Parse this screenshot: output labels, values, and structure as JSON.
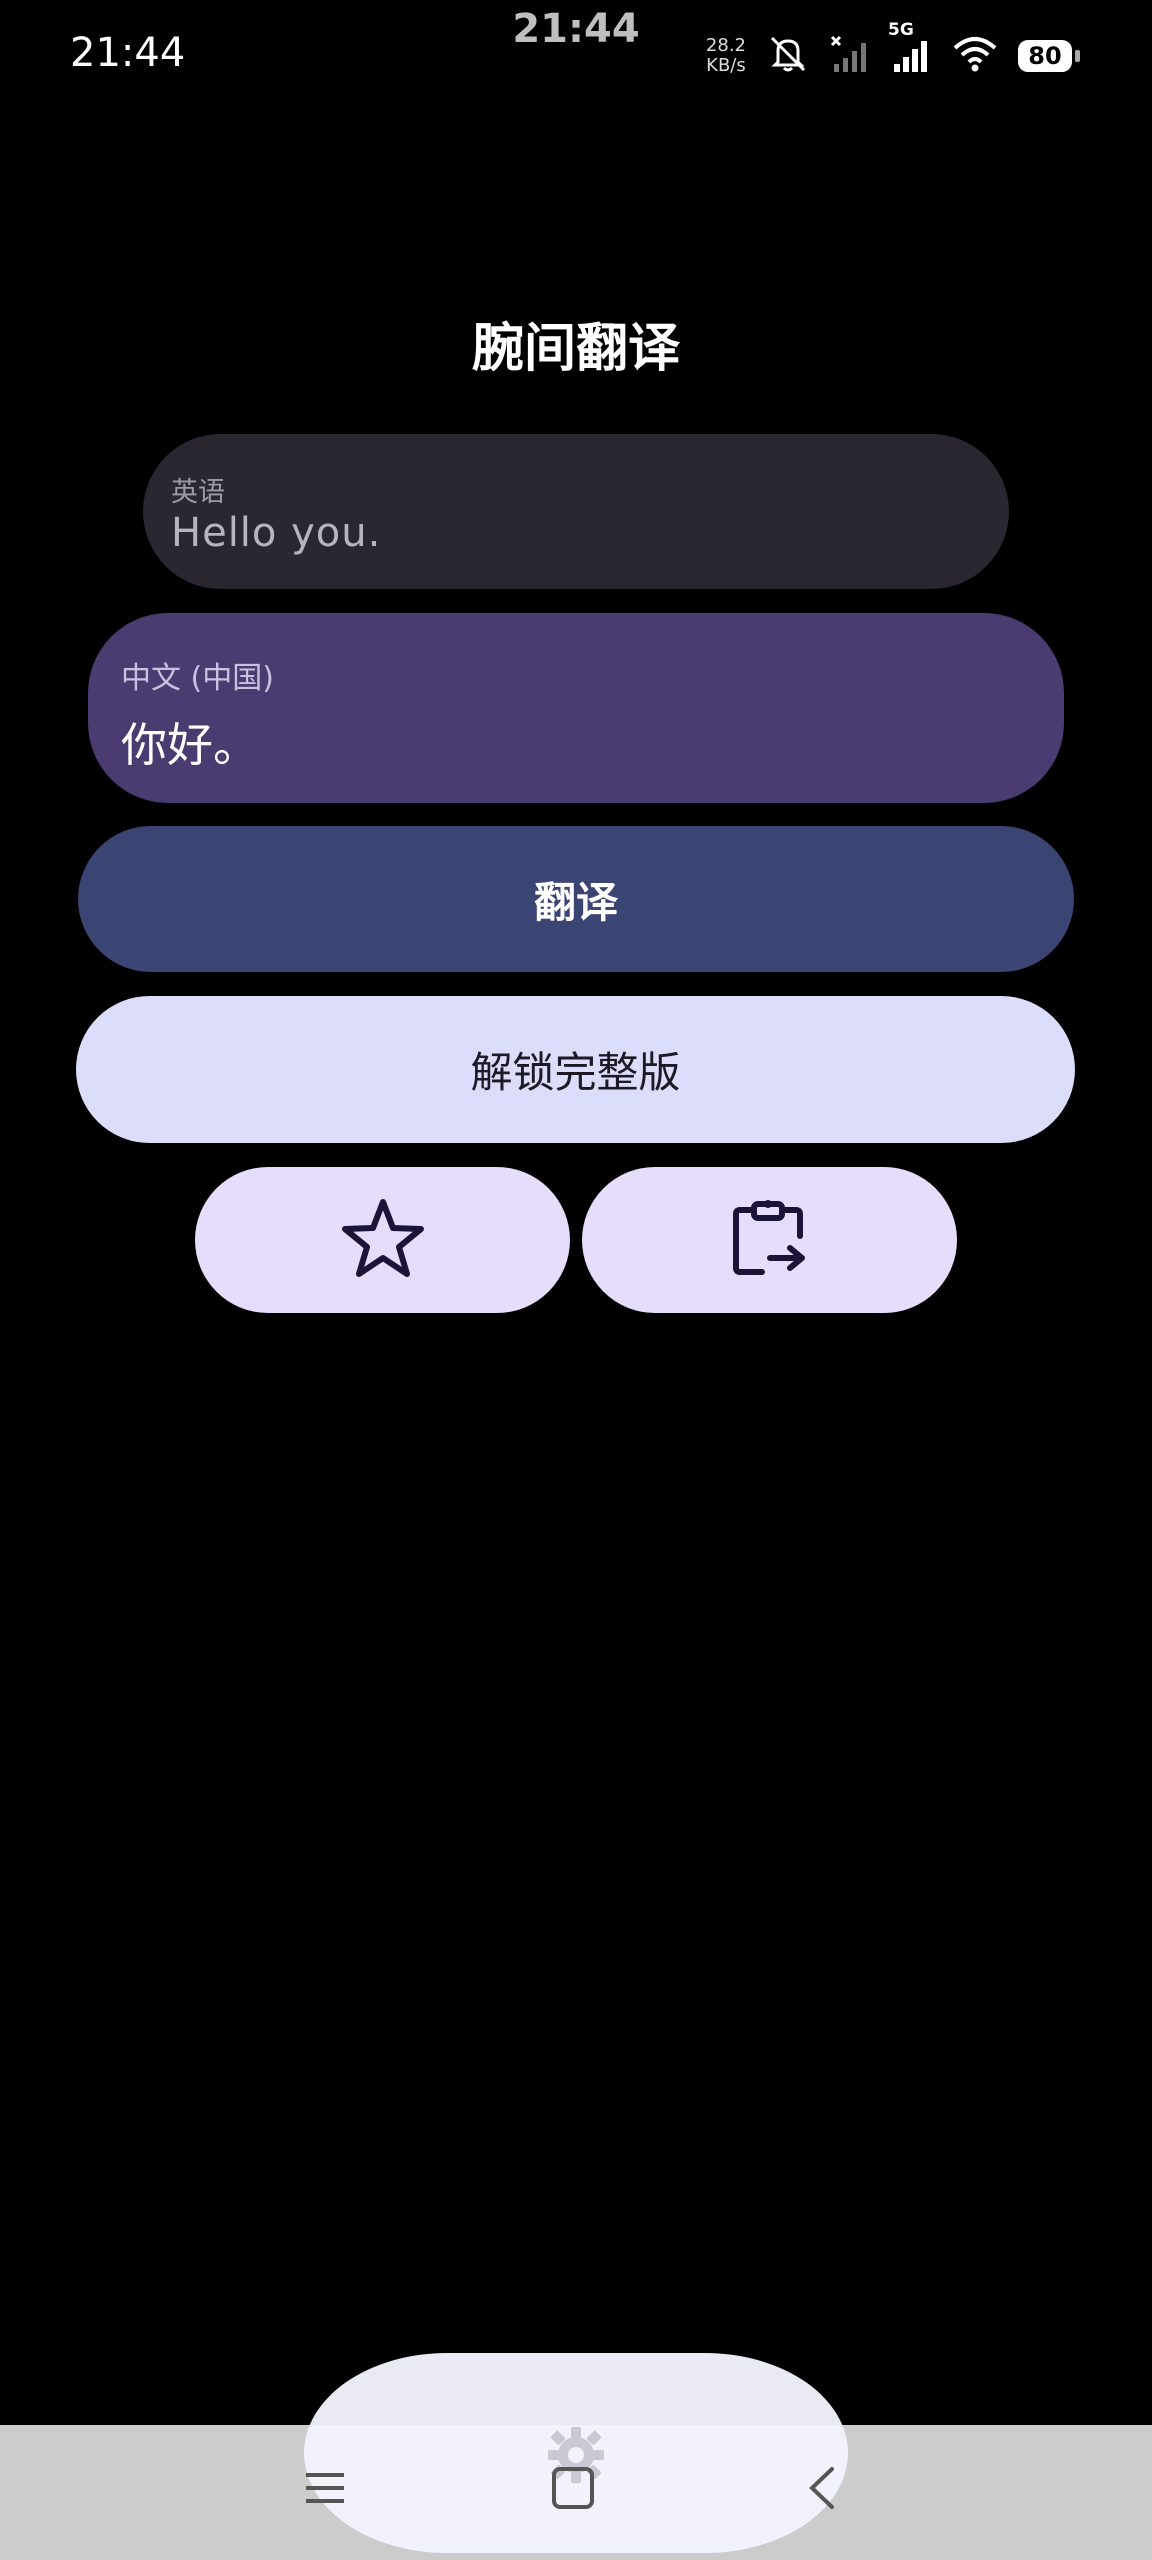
{
  "status_bar": {
    "time": "21:44",
    "center_clock": "21:44",
    "net_speed_value": "28.2",
    "net_speed_unit": "KB/s",
    "network_type": "5G",
    "battery": "80",
    "icons": [
      "mute-icon",
      "signal-off-icon",
      "signal-icon",
      "wifi-icon",
      "battery-icon"
    ]
  },
  "app": {
    "title": "腕间翻译"
  },
  "source": {
    "language": "英语",
    "text": "Hello you."
  },
  "target": {
    "language": "中文 (中国)",
    "text": "你好。"
  },
  "buttons": {
    "translate": "翻译",
    "unlock": "解锁完整版",
    "favorite_icon": "star-icon",
    "copy_icon": "clipboard-export-icon"
  },
  "bottom": {
    "settings_icon": "gear-icon",
    "nav_icons": [
      "menu-icon",
      "home-icon",
      "back-icon"
    ]
  },
  "colors": {
    "background": "#000000",
    "source_card": "#2a2731",
    "target_card": "#4a3b70",
    "translate_button": "#3b4574",
    "unlock_button": "#dcdcfb",
    "icon_buttons": "#e6dcfb"
  }
}
